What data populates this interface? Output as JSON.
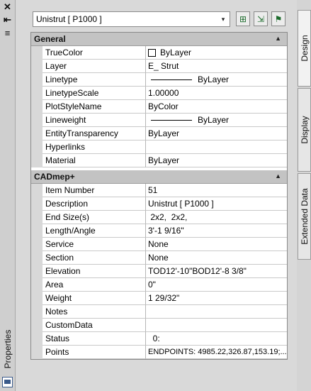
{
  "palette": {
    "title": "Properties",
    "close_glyph": "✕",
    "autohide_glyph": "⇤",
    "menu_glyph": "≡"
  },
  "header": {
    "selector_value": "Unistrut [ P1000 ]",
    "selector_arrow": "▾",
    "tools": [
      {
        "name": "select-objects-icon",
        "glyph": "⊞"
      },
      {
        "name": "quick-select-icon",
        "glyph": "⇲"
      },
      {
        "name": "toggle-pickadd-icon",
        "glyph": "⚑"
      }
    ]
  },
  "sections": [
    {
      "title": "General",
      "toggle": "▲",
      "rows": [
        {
          "name": "TrueColor",
          "value": "ByLayer"
        },
        {
          "name": "Layer",
          "value": "E_ Strut"
        },
        {
          "name": "Linetype",
          "value": "ByLayer"
        },
        {
          "name": "LinetypeScale",
          "value": "1.00000"
        },
        {
          "name": "PlotStyleName",
          "value": "ByColor"
        },
        {
          "name": "Lineweight",
          "value": "ByLayer"
        },
        {
          "name": "EntityTransparency",
          "value": "ByLayer"
        },
        {
          "name": "Hyperlinks",
          "value": ""
        },
        {
          "name": "Material",
          "value": "ByLayer"
        }
      ]
    },
    {
      "title": "CADmep+",
      "toggle": "▲",
      "rows": [
        {
          "name": "Item Number",
          "value": "51"
        },
        {
          "name": "Description",
          "value": "Unistrut [ P1000 ]"
        },
        {
          "name": "End Size(s)",
          "value": " 2x2,  2x2,"
        },
        {
          "name": "Length/Angle",
          "value": "3'-1 9/16\""
        },
        {
          "name": "Service",
          "value": "None"
        },
        {
          "name": "Section",
          "value": "None"
        },
        {
          "name": "Elevation",
          "value": "TOD12'-10\"BOD12'-8 3/8\""
        },
        {
          "name": "Area",
          "value": "0\""
        },
        {
          "name": "Weight",
          "value": "1 29/32\""
        },
        {
          "name": "Notes",
          "value": ""
        },
        {
          "name": "CustomData",
          "value": ""
        },
        {
          "name": "Status",
          "value": "  0:"
        },
        {
          "name": "Points",
          "value": "ENDPOINTS: 4985.22,326.87,153.19;..."
        }
      ]
    }
  ],
  "tabs": [
    {
      "label": "Design",
      "active": true
    },
    {
      "label": "Display",
      "active": false
    },
    {
      "label": "Extended Data",
      "active": false
    }
  ]
}
